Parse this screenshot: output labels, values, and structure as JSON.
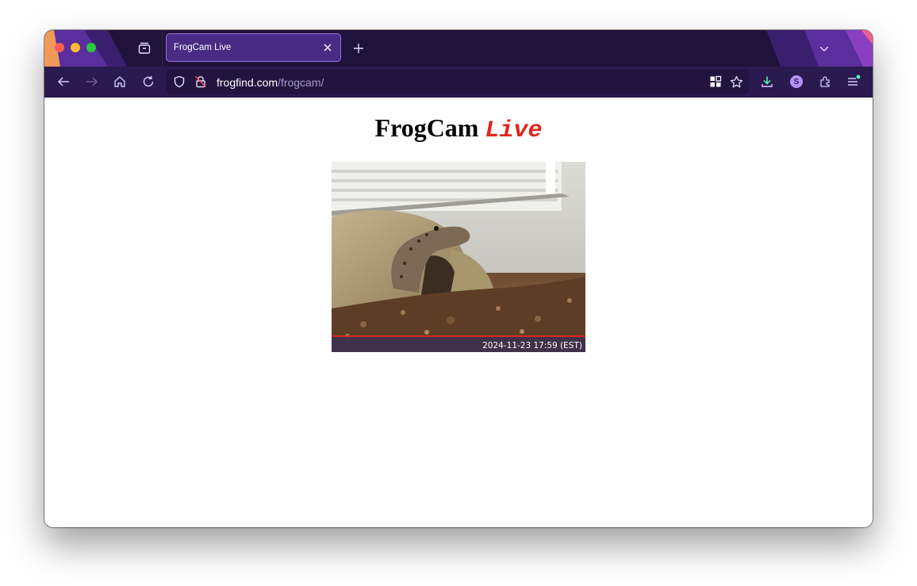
{
  "browser": {
    "tab_title": "FrogCam Live",
    "url_host": "frogfind.com",
    "url_path": "/frogcam/",
    "account_initial": "S",
    "icons": [
      "tabs-icon",
      "close-icon",
      "plus-icon",
      "chevron-down-icon",
      "back-arrow-icon",
      "forward-arrow-icon",
      "home-icon",
      "reload-icon",
      "shield-icon",
      "insecure-lock-icon",
      "qr-grid-icon",
      "star-icon",
      "download-icon",
      "account-icon",
      "extensions-icon",
      "menu-icon"
    ],
    "colors": {
      "tabbar": "#20123a",
      "navbar": "#2b1a4f",
      "active_tab": "#4a2b84",
      "accent": "#b792ff"
    }
  },
  "page": {
    "title_main": "FrogCam",
    "title_accent": "Live",
    "accent_color": "#e0251b",
    "camera": {
      "timestamp": "2024-11-23 17:59 (EST)"
    }
  }
}
